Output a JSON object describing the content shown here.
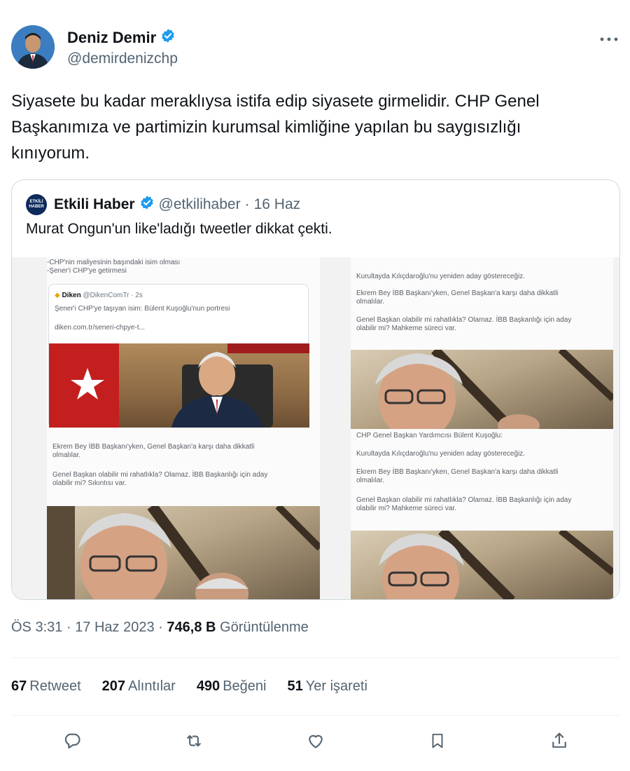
{
  "author": {
    "display_name": "Deniz Demir",
    "handle": "@demirdenizchp",
    "verified": true,
    "verified_color": "#1d9bf0"
  },
  "tweet": {
    "text_lines": [
      "Siyasete bu kadar meraklıysa istifa edip siyasete girmelidir. CHP Genel",
      "Başkanımıza ve partimizin kurumsal kimliğine yapılan bu saygısızlığı",
      "kınıyorum."
    ]
  },
  "quoted": {
    "display_name": "Etkili Haber",
    "handle": "@etkilihaber",
    "separator": "·",
    "date": "16 Haz",
    "text": "Murat Ongun'un like'ladığı tweetler dikkat çekti.",
    "avatar_text": "ETKİLİ HABER",
    "image_tiles": {
      "tl": {
        "lines": [
          "-CHP'nin maliyesinin başındaki isim olması",
          "-Şener'i CHP'ye getirmesi"
        ],
        "card_source": "Diken",
        "card_handle": "@DikenComTr · 2s",
        "card_title": "Şener'i CHP'ye taşıyan isim: Bülent Kuşoğlu'nun portresi",
        "card_link": "diken.com.tr/seneri-chpye-t..."
      },
      "tr": {
        "lines": [
          "Kurultayda Kılıçdaroğlu'nu yeniden aday göstereceğiz.",
          "Ekrem Bey İBB Başkanı'yken, Genel Başkan'a karşı daha dikkatli",
          "olmalılar.",
          "Genel Başkan olabilir mi rahatlıkla? Olamaz. İBB Başkanlığı için aday",
          "olabilir mi? Mahkeme süreci var."
        ]
      },
      "bl": {
        "lines": [
          "Ekrem Bey İBB Başkanı'yken, Genel Başkan'a karşı daha dikkatli",
          "olmalılar.",
          "Genel Başkan olabilir mi rahatlıkla? Olamaz. İBB Başkanlığı için aday",
          "olabilir mi? Sıkıntısı var."
        ]
      },
      "br": {
        "lines": [
          "CHP Genel Başkan Yardımcısı Bülent Kuşoğlu:",
          "Kurultayda Kılıçdaroğlu'nu yeniden aday göstereceğiz.",
          "Ekrem Bey İBB Başkanı'yken, Genel Başkan'a karşı daha dikkatli",
          "olmalılar.",
          "Genel Başkan olabilir mi rahatlıkla? Olamaz. İBB Başkanlığı için aday",
          "olabilir mi? Mahkeme süreci var."
        ]
      }
    }
  },
  "meta": {
    "time": "ÖS 3:31",
    "separator": "·",
    "date": "17 Haz 2023",
    "views_count": "746,8 B",
    "views_label": "Görüntülenme"
  },
  "stats": [
    {
      "count": "67",
      "label": "Retweet"
    },
    {
      "count": "207",
      "label": "Alıntılar"
    },
    {
      "count": "490",
      "label": "Beğeni"
    },
    {
      "count": "51",
      "label": "Yer işareti"
    }
  ],
  "actions": [
    "reply-icon",
    "retweet-icon",
    "like-icon",
    "bookmark-icon",
    "share-icon"
  ],
  "colors": {
    "text_primary": "#0f1419",
    "text_secondary": "#536471",
    "border": "#cfd9de",
    "verified": "#1d9bf0"
  }
}
